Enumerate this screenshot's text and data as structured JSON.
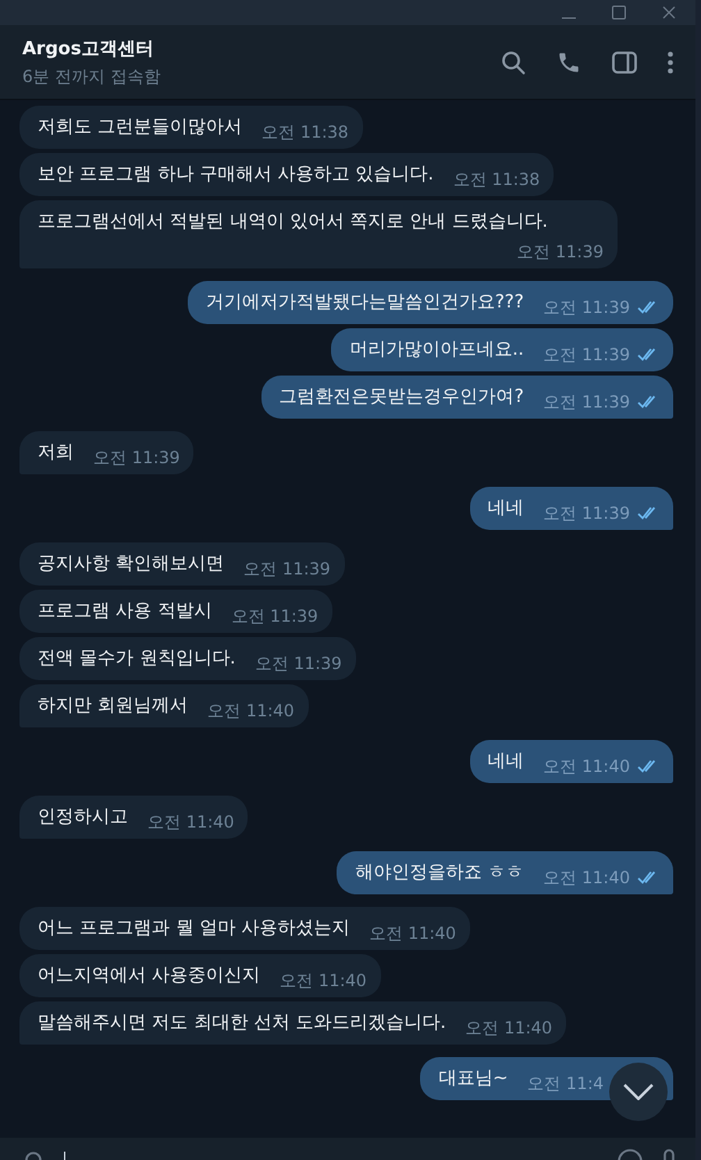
{
  "chat": {
    "title": "Argos고객센터",
    "status": "6분 전까지 접속함"
  },
  "messages": [
    {
      "kind": "incoming",
      "text": "저희도 그런분들이많아서",
      "time": "오전 11:38"
    },
    {
      "kind": "incoming",
      "text": "보안 프로그램 하나 구매해서 사용하고 있습니다.",
      "time": "오전 11:38"
    },
    {
      "kind": "incoming",
      "text": "프로그램선에서 적발된 내역이 있어서 쪽지로 안내 드렸습니다.",
      "time": "오전 11:39"
    },
    {
      "kind": "outgoing",
      "text": "거기에저가적발됐다는말씀인건가요???",
      "time": "오전 11:39",
      "read": true
    },
    {
      "kind": "outgoing",
      "text": "머리가많이아프네요..",
      "time": "오전 11:39",
      "read": true
    },
    {
      "kind": "outgoing",
      "text": "그럼환전은못받는경우인가여?",
      "time": "오전 11:39",
      "read": true
    },
    {
      "kind": "incoming",
      "text": "저희",
      "time": "오전 11:39"
    },
    {
      "kind": "outgoing",
      "text": "네네",
      "time": "오전 11:39",
      "read": true
    },
    {
      "kind": "incoming",
      "text": "공지사항 확인해보시면",
      "time": "오전 11:39"
    },
    {
      "kind": "incoming",
      "text": "프로그램 사용 적발시",
      "time": "오전 11:39"
    },
    {
      "kind": "incoming",
      "text": "전액 몰수가 원칙입니다.",
      "time": "오전 11:39"
    },
    {
      "kind": "incoming",
      "text": "하지만 회원님께서",
      "time": "오전 11:40"
    },
    {
      "kind": "outgoing",
      "text": "네네",
      "time": "오전 11:40",
      "read": true
    },
    {
      "kind": "incoming",
      "text": "인정하시고",
      "time": "오전 11:40"
    },
    {
      "kind": "outgoing",
      "text": "해야인정을하죠 ㅎㅎ",
      "time": "오전 11:40",
      "read": true
    },
    {
      "kind": "incoming",
      "text": "어느 프로그램과 뭘 얼마 사용하셨는지",
      "time": "오전 11:40"
    },
    {
      "kind": "incoming",
      "text": "어느지역에서 사용중이신지",
      "time": "오전 11:40"
    },
    {
      "kind": "incoming",
      "text": "말씀해주시면 저도 최대한 선처 도와드리겠습니다.",
      "time": "오전 11:40"
    },
    {
      "kind": "outgoing",
      "text": "대표님~",
      "time": "오전 11:4"
    }
  ]
}
